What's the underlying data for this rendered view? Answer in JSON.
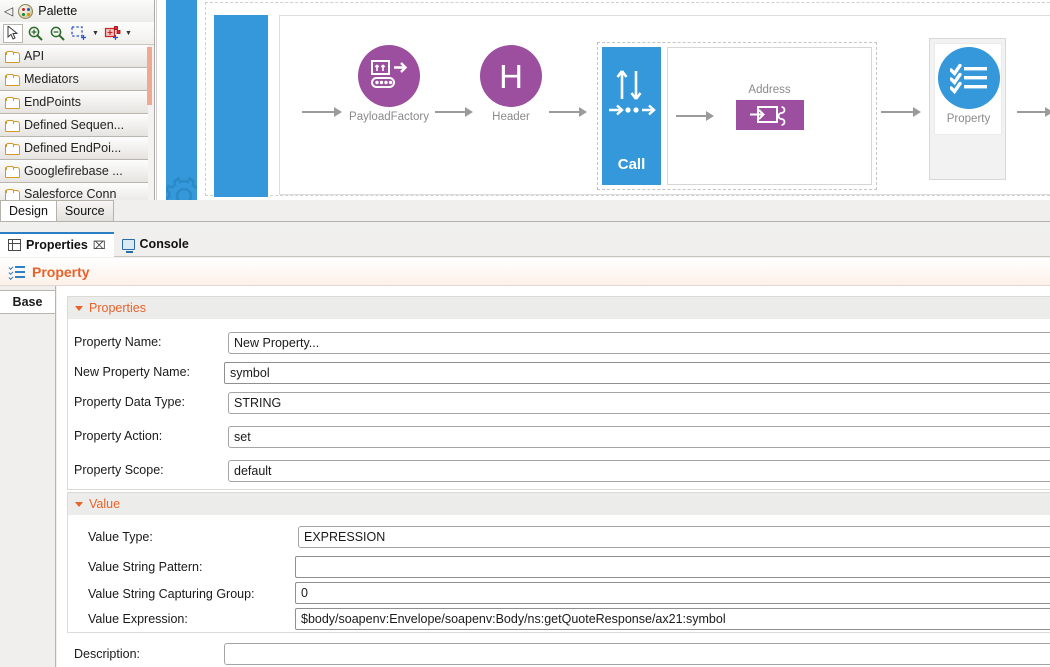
{
  "palette": {
    "title": "Palette",
    "collapse_glyph": "◁",
    "toolbar": [
      {
        "name": "select-tool",
        "glyph": "arrow"
      },
      {
        "name": "zoom-in-tool",
        "glyph": "zoom-in"
      },
      {
        "name": "zoom-out-tool",
        "glyph": "zoom-out"
      },
      {
        "name": "marquee-tool",
        "glyph": "marquee"
      },
      {
        "name": "create-node-tool",
        "glyph": "create-node"
      }
    ],
    "items": [
      {
        "label": "API"
      },
      {
        "label": "Mediators"
      },
      {
        "label": "EndPoints"
      },
      {
        "label": "Defined Sequen..."
      },
      {
        "label": "Defined EndPoi..."
      },
      {
        "label": "Googlefirebase ..."
      },
      {
        "label": "Salesforce Conn"
      }
    ]
  },
  "canvas": {
    "nodes": [
      {
        "label": "PayloadFactory",
        "icon": "payload-factory-icon",
        "color": "#9b4f9e"
      },
      {
        "label": "Header",
        "icon": "header-icon",
        "glyph": "H",
        "color": "#9b4f9e"
      },
      {
        "label": "Call",
        "icon": "call-icon",
        "color": "#3498db"
      },
      {
        "label": "Address",
        "icon": "address-endpoint-icon",
        "color": "#9b4f9e"
      },
      {
        "label": "Property",
        "icon": "property-icon",
        "color": "#3498db"
      }
    ]
  },
  "editor_tabs": [
    {
      "label": "Design",
      "active": true
    },
    {
      "label": "Source",
      "active": false
    }
  ],
  "view_tabs": [
    {
      "label": "Properties",
      "icon": "properties-grid-icon",
      "active": true,
      "close_glyph": "⌧"
    },
    {
      "label": "Console",
      "icon": "console-monitor-icon",
      "active": false
    }
  ],
  "header": {
    "title": "Property",
    "icon": "property-list-icon",
    "accent": "#e8622a"
  },
  "left_tabs": [
    {
      "label": "Base",
      "active": true
    }
  ],
  "sections": [
    {
      "title": "Properties",
      "rows": [
        {
          "label": "Property Name:",
          "value": "New Property...",
          "field": "property-name"
        },
        {
          "label": "New Property Name:",
          "value": "symbol",
          "field": "new-property-name"
        },
        {
          "label": "Property Data Type:",
          "value": "STRING",
          "field": "property-data-type"
        },
        {
          "label": "Property Action:",
          "value": "set",
          "field": "property-action"
        },
        {
          "label": "Property Scope:",
          "value": "default",
          "field": "property-scope"
        }
      ]
    },
    {
      "title": "Value",
      "rows": [
        {
          "label": "Value Type:",
          "value": "EXPRESSION",
          "field": "value-type"
        },
        {
          "label": "Value String Pattern:",
          "value": "",
          "field": "value-string-pattern"
        },
        {
          "label": "Value String Capturing Group:",
          "value": "0",
          "field": "value-string-capturing-group"
        },
        {
          "label": "Value Expression:",
          "value": "$body/soapenv:Envelope/soapenv:Body/ns:getQuoteResponse/ax21:symbol",
          "field": "value-expression"
        }
      ]
    }
  ],
  "description": {
    "label": "Description:",
    "value": ""
  }
}
